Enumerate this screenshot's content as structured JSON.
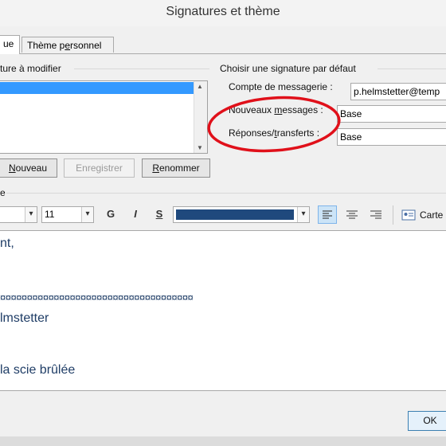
{
  "window": {
    "title": "Signatures et thème"
  },
  "tabs": [
    {
      "label": "ue",
      "active": true
    },
    {
      "label_before": "Thème p",
      "label_ul": "e",
      "label_after": "rsonnel",
      "active": false
    }
  ],
  "left_group": {
    "title": "ture à modifier",
    "buttons": {
      "new": {
        "ul": "N",
        "rest": "ouveau"
      },
      "save": "Enregistrer",
      "rename": {
        "ul": "R",
        "rest": "enommer"
      }
    }
  },
  "default_group": {
    "title": "Choisir une signature par défaut",
    "account": {
      "label": "Compte de messagerie :",
      "value": "p.helmstetter@temp"
    },
    "new_messages": {
      "label_before": "Nouveaux ",
      "label_ul": "m",
      "label_after": "essages :",
      "value": "Base"
    },
    "replies": {
      "label_before": "Réponses/",
      "label_ul": "t",
      "label_after": "ransferts :",
      "value": "Base"
    }
  },
  "edit_section_label": "e",
  "toolbar": {
    "font_size": "11",
    "bold": "G",
    "italic": "I",
    "underline": "S",
    "font_color": "#1f497d",
    "card_label": "Carte"
  },
  "editor_lines": {
    "l1": "nt,",
    "l2": "¤¤¤¤¤¤¤¤¤¤¤¤¤¤¤¤¤¤¤¤¤¤¤¤¤¤¤¤¤¤¤¤¤¤¤¤",
    "l3": "lmstetter",
    "l4": "la  scie  brûlée"
  },
  "footer": {
    "ok": "OK"
  },
  "colors": {
    "accent": "#1f497d",
    "annotation_circle": "#e0101a"
  }
}
